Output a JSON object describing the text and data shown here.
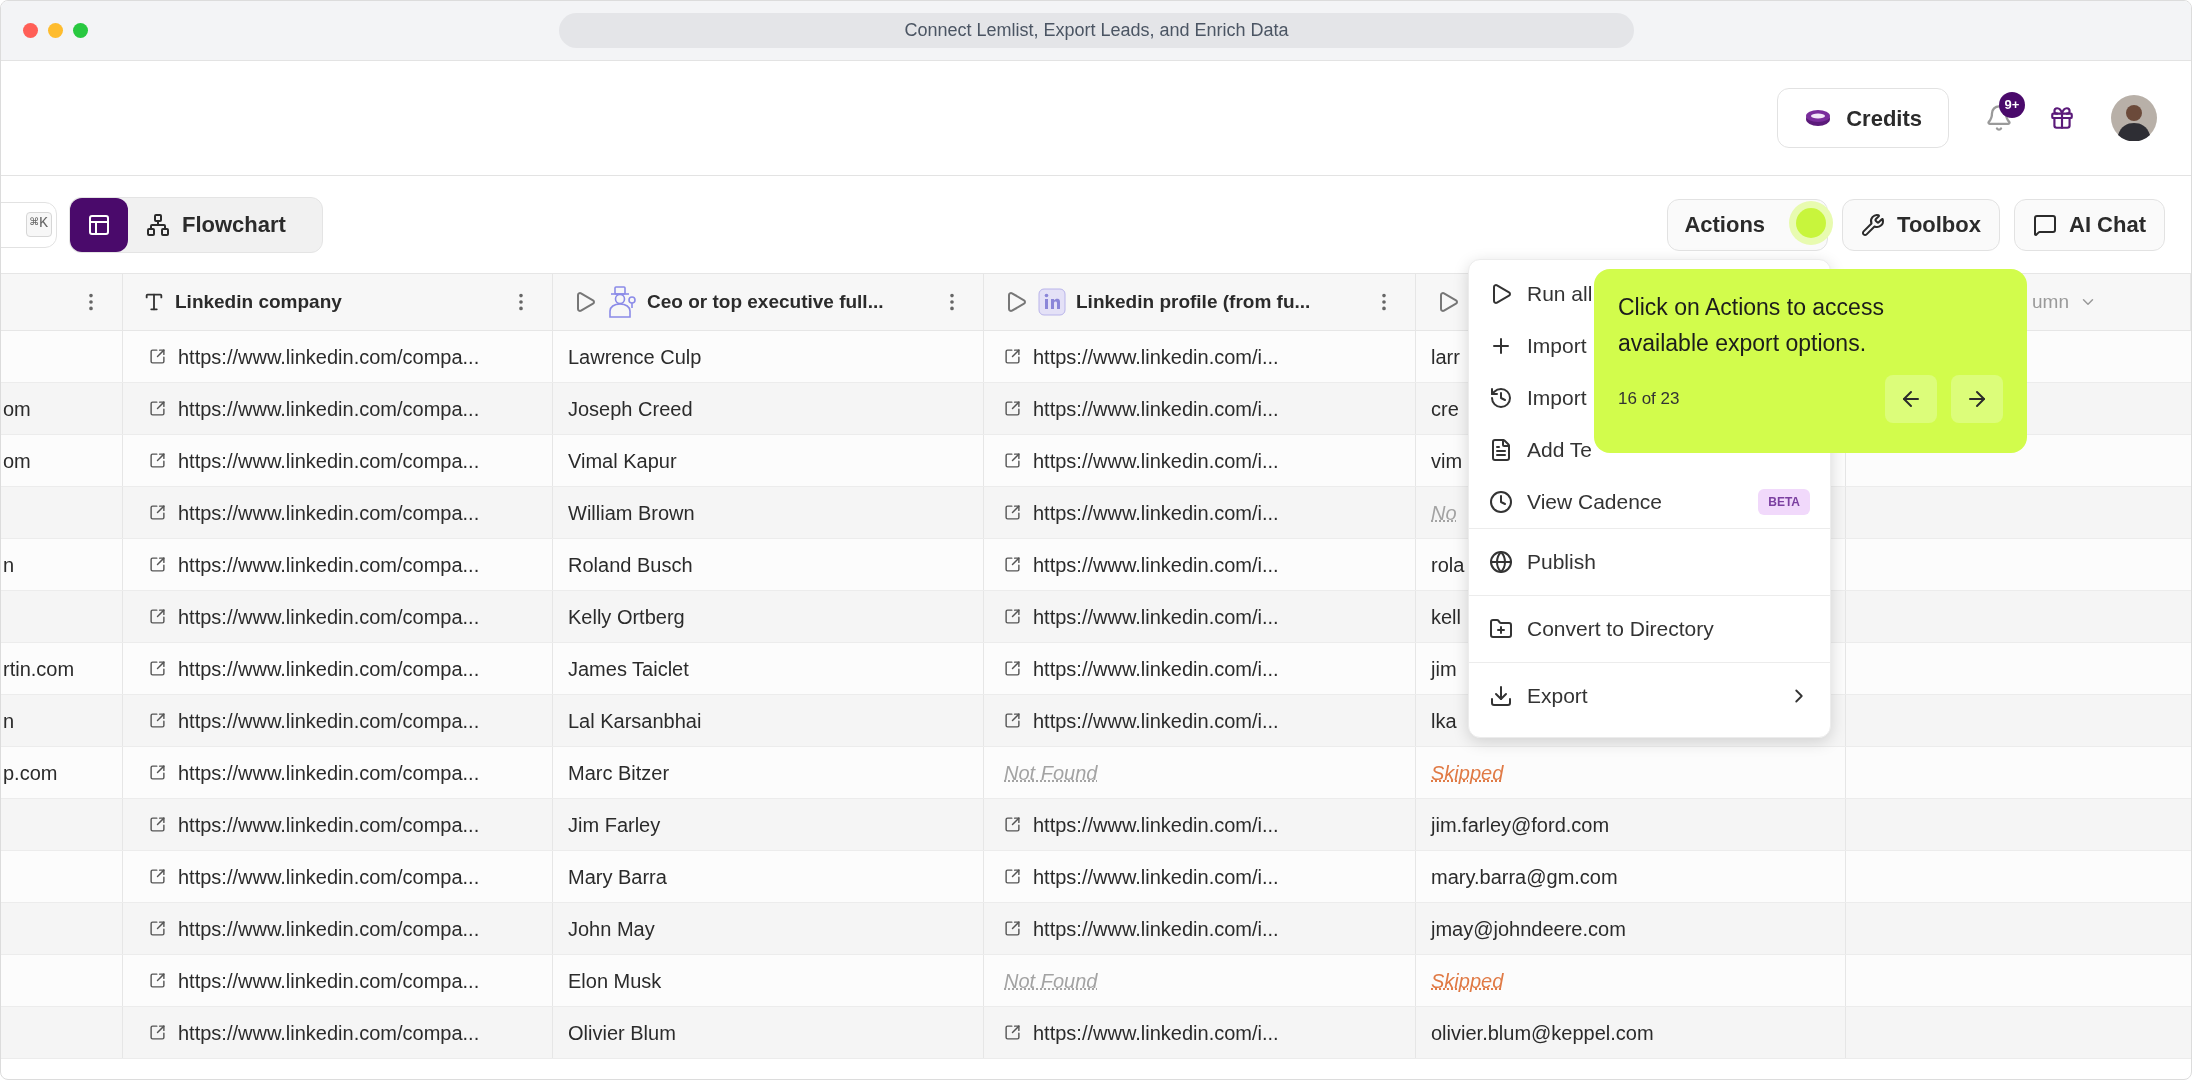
{
  "window": {
    "title": "Connect Lemlist, Export Leads, and Enrich Data"
  },
  "header": {
    "credits_button": "Credits",
    "notification_badge": "9+"
  },
  "toolbar": {
    "shortcut_key": "⌘K",
    "views": [
      {
        "kind": "table",
        "selected": true
      },
      {
        "kind": "flowchart",
        "label": "Flowchart",
        "selected": false
      }
    ],
    "buttons": [
      {
        "kind": "actions",
        "label": "Actions"
      },
      {
        "kind": "toolbox",
        "label": "Toolbox"
      },
      {
        "kind": "chat",
        "label": "AI Chat"
      }
    ]
  },
  "table": {
    "columns": [
      {
        "kind": "cut"
      },
      {
        "kind": "text",
        "label": "Linkedin company"
      },
      {
        "kind": "ceo",
        "label": "Ceo or top executive full..."
      },
      {
        "kind": "linkedin",
        "label": "Linkedin profile (from fu..."
      },
      {
        "kind": "hidden"
      },
      {
        "kind": "add",
        "label": "umn"
      }
    ],
    "rows": [
      {
        "column_1": "",
        "company": "https://www.linkedin.com/compa...",
        "ceo": "Lawrence Culp",
        "profile": {
          "kind": "link",
          "text": "https://www.linkedin.com/i..."
        },
        "email": {
          "kind": "text",
          "text": "larr"
        }
      },
      {
        "column_1": "om",
        "company": "https://www.linkedin.com/compa...",
        "ceo": "Joseph Creed",
        "profile": {
          "kind": "link",
          "text": "https://www.linkedin.com/i..."
        },
        "email": {
          "kind": "text",
          "text": "cre"
        }
      },
      {
        "column_1": "om",
        "company": "https://www.linkedin.com/compa...",
        "ceo": "Vimal Kapur",
        "profile": {
          "kind": "link",
          "text": "https://www.linkedin.com/i..."
        },
        "email": {
          "kind": "text",
          "text": "vim"
        }
      },
      {
        "column_1": "",
        "company": "https://www.linkedin.com/compa...",
        "ceo": "William Brown",
        "profile": {
          "kind": "link",
          "text": "https://www.linkedin.com/i..."
        },
        "email": {
          "kind": "not_found",
          "text": "No"
        }
      },
      {
        "column_1": "n",
        "company": "https://www.linkedin.com/compa...",
        "ceo": "Roland Busch",
        "profile": {
          "kind": "link",
          "text": "https://www.linkedin.com/i..."
        },
        "email": {
          "kind": "text",
          "text": "rola"
        }
      },
      {
        "column_1": "",
        "company": "https://www.linkedin.com/compa...",
        "ceo": "Kelly Ortberg",
        "profile": {
          "kind": "link",
          "text": "https://www.linkedin.com/i..."
        },
        "email": {
          "kind": "text",
          "text": "kell"
        }
      },
      {
        "column_1": "rtin.com",
        "company": "https://www.linkedin.com/compa...",
        "ceo": "James Taiclet",
        "profile": {
          "kind": "link",
          "text": "https://www.linkedin.com/i..."
        },
        "email": {
          "kind": "text",
          "text": "jim"
        }
      },
      {
        "column_1": "n",
        "company": "https://www.linkedin.com/compa...",
        "ceo": "Lal Karsanbhai",
        "profile": {
          "kind": "link",
          "text": "https://www.linkedin.com/i..."
        },
        "email": {
          "kind": "text",
          "text": "lka"
        }
      },
      {
        "column_1": "p.com",
        "company": "https://www.linkedin.com/compa...",
        "ceo": "Marc Bitzer",
        "profile": {
          "kind": "not_found",
          "text": "Not Found"
        },
        "email": {
          "kind": "skipped",
          "text": "Skipped"
        }
      },
      {
        "column_1": "",
        "company": "https://www.linkedin.com/compa...",
        "ceo": "Jim Farley",
        "profile": {
          "kind": "link",
          "text": "https://www.linkedin.com/i..."
        },
        "email": {
          "kind": "text",
          "text": "jim.farley@ford.com"
        }
      },
      {
        "column_1": "",
        "company": "https://www.linkedin.com/compa...",
        "ceo": "Mary Barra",
        "profile": {
          "kind": "link",
          "text": "https://www.linkedin.com/i..."
        },
        "email": {
          "kind": "text",
          "text": "mary.barra@gm.com"
        }
      },
      {
        "column_1": "",
        "company": "https://www.linkedin.com/compa...",
        "ceo": "John May",
        "profile": {
          "kind": "link",
          "text": "https://www.linkedin.com/i..."
        },
        "email": {
          "kind": "text",
          "text": "jmay@johndeere.com"
        }
      },
      {
        "column_1": "",
        "company": "https://www.linkedin.com/compa...",
        "ceo": "Elon Musk",
        "profile": {
          "kind": "not_found",
          "text": "Not Found"
        },
        "email": {
          "kind": "skipped",
          "text": "Skipped"
        }
      },
      {
        "column_1": "",
        "company": "https://www.linkedin.com/compa...",
        "ceo": "Olivier Blum",
        "profile": {
          "kind": "link",
          "text": "https://www.linkedin.com/i..."
        },
        "email": {
          "kind": "text",
          "text": "olivier.blum@keppel.com"
        }
      }
    ]
  },
  "menu": {
    "sections": [
      {
        "items": [
          {
            "kind": "run",
            "label": "Run all"
          },
          {
            "kind": "import",
            "label": "Import"
          },
          {
            "kind": "history",
            "label": "Import"
          },
          {
            "kind": "file",
            "label": "Add Te"
          },
          {
            "kind": "clock",
            "label": "View Cadence",
            "badge": "BETA"
          }
        ]
      },
      {
        "items": [
          {
            "kind": "globe",
            "label": "Publish"
          }
        ]
      },
      {
        "items": [
          {
            "kind": "folder",
            "label": "Convert to Directory"
          }
        ]
      },
      {
        "items": [
          {
            "kind": "download",
            "label": "Export",
            "submenu": true
          }
        ]
      }
    ]
  },
  "tooltip": {
    "text": "Click on Actions to access available export options.",
    "step": "16 of 23"
  }
}
